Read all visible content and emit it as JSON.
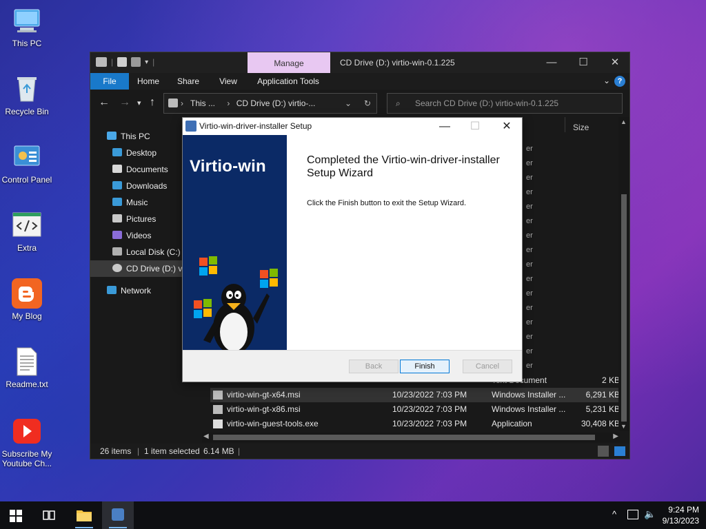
{
  "desktop": {
    "icons": [
      {
        "label": "This PC"
      },
      {
        "label": "Recycle Bin"
      },
      {
        "label": "Control Panel"
      },
      {
        "label": "Extra"
      },
      {
        "label": "My Blog"
      },
      {
        "label": "Readme.txt"
      },
      {
        "label": "Subscribe My Youtube Ch..."
      }
    ]
  },
  "explorer": {
    "manage_tab": "Manage",
    "title": "CD Drive (D:) virtio-win-0.1.225",
    "ribbon": {
      "file": "File",
      "home": "Home",
      "share": "Share",
      "view": "View",
      "app_tools": "Application Tools"
    },
    "address": {
      "crumb1": "This ...",
      "sep1": "›",
      "crumb2": "CD Drive (D:) virtio-...",
      "sep0": "›"
    },
    "search_placeholder": "Search CD Drive (D:) virtio-win-0.1.225",
    "sidebar": [
      {
        "label": "This PC"
      },
      {
        "label": "Desktop"
      },
      {
        "label": "Documents"
      },
      {
        "label": "Downloads"
      },
      {
        "label": "Music"
      },
      {
        "label": "Pictures"
      },
      {
        "label": "Videos"
      },
      {
        "label": "Local Disk (C:)"
      },
      {
        "label": "CD Drive (D:) vi"
      },
      {
        "label": "Network"
      }
    ],
    "column_size": "Size",
    "partial_row": {
      "type": "Text Document",
      "size": "2 KB"
    },
    "files": [
      {
        "name": "virtio-win-gt-x64.msi",
        "date": "10/23/2022 7:03 PM",
        "type": "Windows Installer ...",
        "size": "6,291 KB"
      },
      {
        "name": "virtio-win-gt-x86.msi",
        "date": "10/23/2022 7:03 PM",
        "type": "Windows Installer ...",
        "size": "5,231 KB"
      },
      {
        "name": "virtio-win-guest-tools.exe",
        "date": "10/23/2022 7:03 PM",
        "type": "Application",
        "size": "30,408 KB"
      }
    ],
    "status": {
      "items": "26 items",
      "selected": "1 item selected",
      "size": "6.14 MB"
    }
  },
  "dialog": {
    "title": "Virtio-win-driver-installer Setup",
    "brand": "Virtio-win",
    "heading": "Completed the Virtio-win-driver-installer Setup Wizard",
    "body": "Click the Finish button to exit the Setup Wizard.",
    "buttons": {
      "back": "Back",
      "finish": "Finish",
      "cancel": "Cancel"
    }
  },
  "taskbar": {
    "time": "9:24 PM",
    "date": "9/13/2023"
  },
  "colors": {
    "accent": "#1979ca",
    "manage_tab": "#e8c8f2",
    "banner": "#0b2a66"
  }
}
